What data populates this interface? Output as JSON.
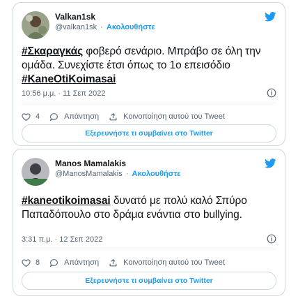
{
  "tweets": [
    {
      "author_name": "Valkan1sk",
      "author_handle": "@valkan1sk",
      "separator": "·",
      "follow_label": "Ακολουθήστε",
      "text_hashtag1": "#Σκαραγκάς",
      "text_main": " φοβερό σενάριο. Μπράβο σε όλη την ομάδα. Συνεχίστε έτσι όπως το 1ο επεισόδιο",
      "text_hashtag2": "#KaneOtiKoimasai",
      "timestamp": "10:56 μ.μ. · 11 Σεπ 2022",
      "like_count": "4",
      "reply_label": "Απάντηση",
      "share_label": "Κοινοποίηση αυτού του Tweet",
      "explore_label": "Εξερευνήστε τι συμβαίνει στο Twitter",
      "avatar_color": "#6b7a5a"
    },
    {
      "author_name": "Manos Mamalakis",
      "author_handle": "@ManosMamalakis",
      "separator": "·",
      "follow_label": "Ακολουθήστε",
      "text_hashtag1": "#kaneotikoimasai",
      "text_main": " δυνατό με πολύ καλό Σπύρο Παπαδόπουλο στο δράμα ενάντια στο bullying.",
      "text_hashtag2": "",
      "timestamp": "3:31 π.μ. · 12 Σεπ 2022",
      "like_count": "8",
      "reply_label": "Απάντηση",
      "share_label": "Κοινοποίηση αυτού του Tweet",
      "explore_label": "Εξερευνήστε τι συμβαίνει στο Twitter",
      "avatar_color": "#4a4f57"
    }
  ],
  "colors": {
    "accent": "#1d9bf0",
    "text": "#0f1419",
    "muted": "#536471",
    "border": "#cfd9de"
  },
  "icons": [
    "twitter-bird-icon",
    "info-icon",
    "heart-icon",
    "reply-icon",
    "share-icon"
  ]
}
